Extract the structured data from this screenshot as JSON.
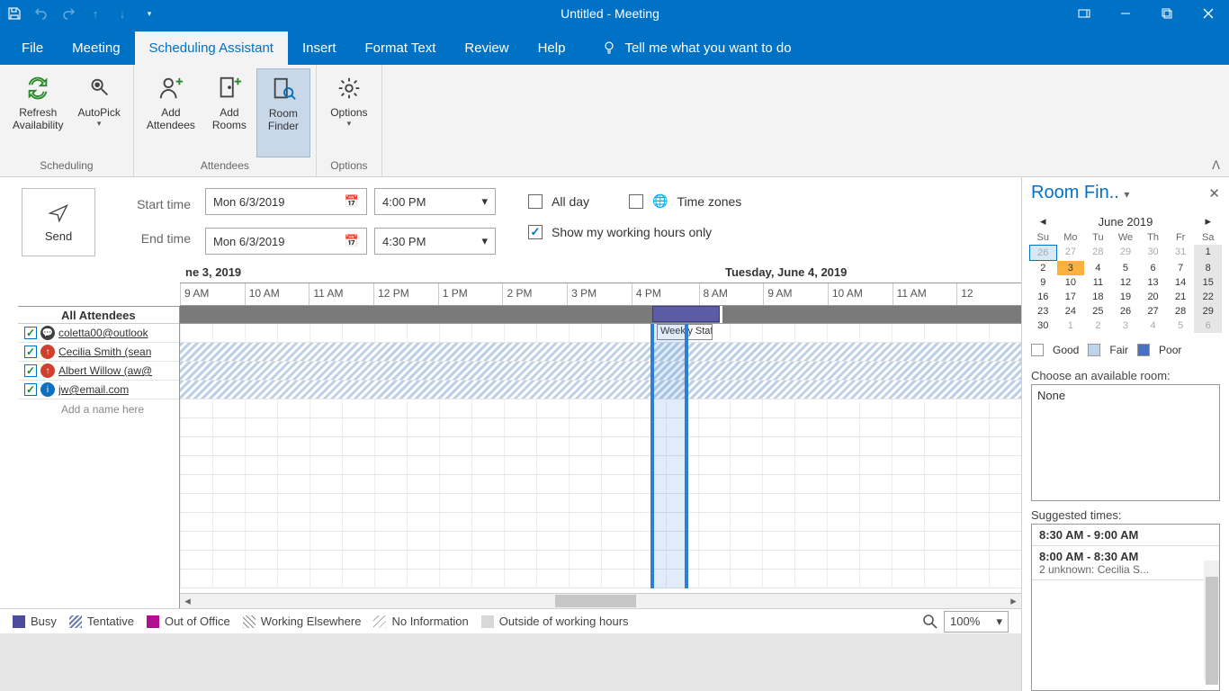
{
  "titlebar": {
    "title": "Untitled  -  Meeting"
  },
  "tabs": {
    "file": "File",
    "meeting": "Meeting",
    "scheduling": "Scheduling Assistant",
    "insert": "Insert",
    "format": "Format Text",
    "review": "Review",
    "help": "Help",
    "tellme": "Tell me what you want to do"
  },
  "ribbon": {
    "refresh": "Refresh\nAvailability",
    "autopick": "AutoPick",
    "addatt": "Add\nAttendees",
    "addrooms": "Add\nRooms",
    "roomfinder": "Room\nFinder",
    "options": "Options",
    "group_scheduling": "Scheduling",
    "group_attendees": "Attendees",
    "group_options": "Options"
  },
  "time": {
    "start_label": "Start time",
    "end_label": "End time",
    "start_date": "Mon 6/3/2019",
    "end_date": "Mon 6/3/2019",
    "start_time": "4:00 PM",
    "end_time": "4:30 PM",
    "allday": "All day",
    "timezones": "Time zones",
    "workhours": "Show my working hours only",
    "send": "Send"
  },
  "attendees": {
    "header": "All Attendees",
    "rows": [
      {
        "name": "coletta00@outlook",
        "status": "organizer"
      },
      {
        "name": "Cecilia Smith (sean",
        "status": "required"
      },
      {
        "name": "Albert Willow (aw@",
        "status": "required"
      },
      {
        "name": "jw@email.com",
        "status": "info"
      }
    ],
    "add": "Add a name here"
  },
  "grid": {
    "day1": "ne 3, 2019",
    "day2": "Tuesday, June 4, 2019",
    "hours": [
      "9 AM",
      "10 AM",
      "11 AM",
      "12 PM",
      "1 PM",
      "2 PM",
      "3 PM",
      "4 PM",
      "8 AM",
      "9 AM",
      "10 AM",
      "11 AM",
      "12"
    ],
    "event1": "Weekly Staf"
  },
  "legend": {
    "busy": "Busy",
    "tentative": "Tentative",
    "ooo": "Out of Office",
    "elsewhere": "Working Elsewhere",
    "noinfo": "No Information",
    "outside": "Outside of working hours"
  },
  "zoom": {
    "value": "100%"
  },
  "roomfinder": {
    "title": "Room Fin..",
    "month": "June 2019",
    "dow": [
      "Su",
      "Mo",
      "Tu",
      "We",
      "Th",
      "Fr",
      "Sa"
    ],
    "weeks": [
      [
        {
          "d": "26",
          "o": true,
          "t": true
        },
        {
          "d": "27",
          "o": true
        },
        {
          "d": "28",
          "o": true
        },
        {
          "d": "29",
          "o": true
        },
        {
          "d": "30",
          "o": true
        },
        {
          "d": "31",
          "o": true
        },
        {
          "d": "1",
          "s": true
        }
      ],
      [
        {
          "d": "2"
        },
        {
          "d": "3",
          "sel": true
        },
        {
          "d": "4"
        },
        {
          "d": "5"
        },
        {
          "d": "6"
        },
        {
          "d": "7"
        },
        {
          "d": "8",
          "s": true
        }
      ],
      [
        {
          "d": "9"
        },
        {
          "d": "10"
        },
        {
          "d": "11"
        },
        {
          "d": "12"
        },
        {
          "d": "13"
        },
        {
          "d": "14"
        },
        {
          "d": "15",
          "s": true
        }
      ],
      [
        {
          "d": "16"
        },
        {
          "d": "17"
        },
        {
          "d": "18"
        },
        {
          "d": "19"
        },
        {
          "d": "20"
        },
        {
          "d": "21"
        },
        {
          "d": "22",
          "s": true
        }
      ],
      [
        {
          "d": "23"
        },
        {
          "d": "24"
        },
        {
          "d": "25"
        },
        {
          "d": "26"
        },
        {
          "d": "27"
        },
        {
          "d": "28"
        },
        {
          "d": "29",
          "s": true
        }
      ],
      [
        {
          "d": "30"
        },
        {
          "d": "1",
          "o": true
        },
        {
          "d": "2",
          "o": true
        },
        {
          "d": "3",
          "o": true
        },
        {
          "d": "4",
          "o": true
        },
        {
          "d": "5",
          "o": true
        },
        {
          "d": "6",
          "o": true,
          "s": true
        }
      ]
    ],
    "legend": {
      "good": "Good",
      "fair": "Fair",
      "poor": "Poor"
    },
    "choose_label": "Choose an available room:",
    "room_none": "None",
    "sugg_label": "Suggested times:",
    "suggestions": [
      {
        "time": "8:00 AM - 8:30 AM",
        "detail": "2 unknown: Cecilia S..."
      },
      {
        "time": "8:30 AM - 9:00 AM",
        "detail": ""
      }
    ]
  }
}
